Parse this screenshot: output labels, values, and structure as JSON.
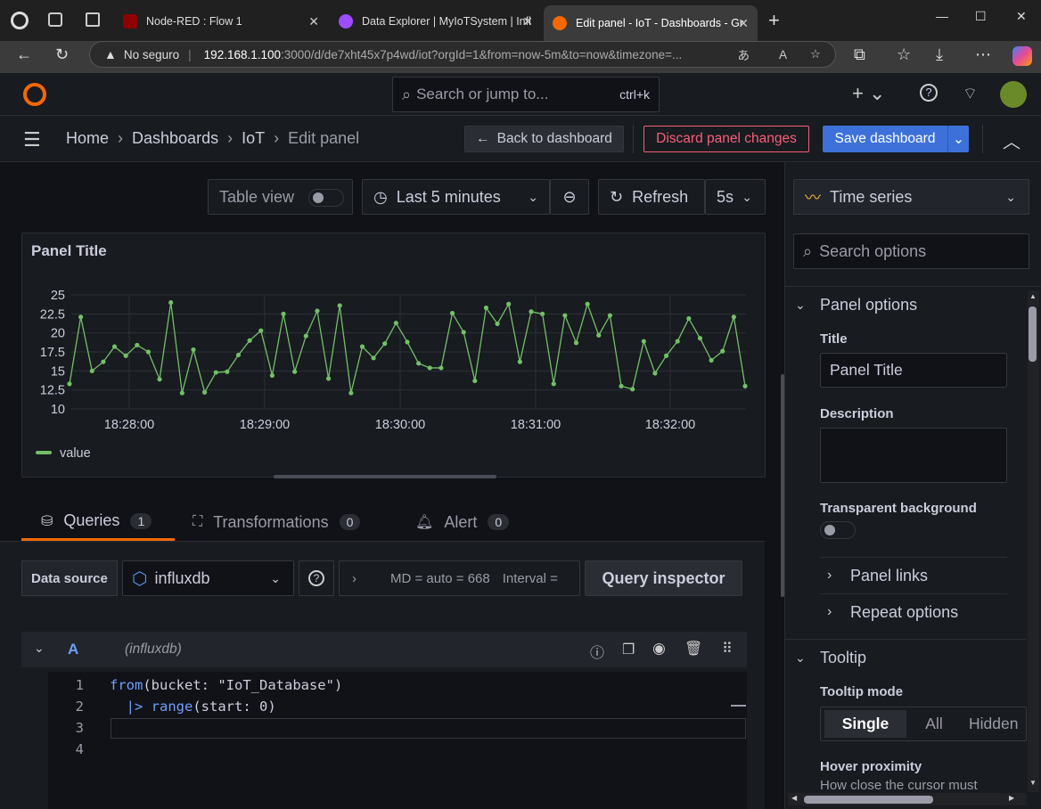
{
  "browser": {
    "tabs": [
      {
        "title": "Node-RED : Flow 1"
      },
      {
        "title": "Data Explorer | MyIoTSystem | Infl"
      },
      {
        "title": "Edit panel - IoT - Dashboards - Gr"
      }
    ],
    "security_label": "No seguro",
    "url_host": "192.168.1.100",
    "url_rest": ":3000/d/de7xht45x7p4wd/iot?orgId=1&from=now-5m&to=now&timezone=..."
  },
  "grafana": {
    "search_placeholder": "Search or jump to...",
    "search_shortcut": "ctrl+k",
    "breadcrumb": [
      "Home",
      "Dashboards",
      "IoT",
      "Edit panel"
    ],
    "back_label": "Back to dashboard",
    "discard_label": "Discard panel changes",
    "save_label": "Save dashboard",
    "table_view_label": "Table view",
    "time_range": "Last 5 minutes",
    "refresh_label": "Refresh",
    "refresh_interval": "5s",
    "panel_title": "Panel Title",
    "tabs": {
      "queries": "Queries",
      "queries_count": "1",
      "transformations": "Transformations",
      "transformations_count": "0",
      "alert": "Alert",
      "alert_count": "0"
    },
    "datasource_label": "Data source",
    "datasource": "influxdb",
    "md_text": "MD = auto = 668",
    "interval_text": "Interval =",
    "query_inspector": "Query inspector",
    "query": {
      "ref": "A",
      "ds": "(influxdb)",
      "lines": [
        {
          "n": "1",
          "parts": [
            {
              "t": "from",
              "c": "#6e9fff"
            },
            {
              "t": "(bucket: ",
              "c": "#ccccdc"
            },
            {
              "t": "\"IoT_Database\"",
              "c": "#ccccdc"
            },
            {
              "t": ")",
              "c": "#ccccdc"
            }
          ]
        },
        {
          "n": "2",
          "parts": [
            {
              "t": "  |> ",
              "c": "#6e9fff"
            },
            {
              "t": "range",
              "c": "#6e9fff"
            },
            {
              "t": "(start: ",
              "c": "#ccccdc"
            },
            {
              "t": "0",
              "c": "#ccccdc"
            },
            {
              "t": ")",
              "c": "#ccccdc"
            }
          ]
        },
        {
          "n": "3",
          "parts": []
        },
        {
          "n": "4",
          "parts": []
        }
      ]
    }
  },
  "side": {
    "viz": "Time series",
    "search_options": "Search options",
    "panel_options": "Panel options",
    "title_label": "Title",
    "title_value": "Panel Title",
    "description_label": "Description",
    "transparent_label": "Transparent background",
    "panel_links": "Panel links",
    "repeat_options": "Repeat options",
    "tooltip": "Tooltip",
    "tooltip_mode_label": "Tooltip mode",
    "tooltip_modes": [
      "Single",
      "All",
      "Hidden"
    ],
    "hover_label": "Hover proximity",
    "hover_desc": "How close the cursor must"
  },
  "chart_data": {
    "type": "line",
    "title": "Panel Title",
    "ylim": [
      10,
      25
    ],
    "y_ticks": [
      "25",
      "22.5",
      "20",
      "17.5",
      "15",
      "12.5",
      "10"
    ],
    "x_ticks": [
      "18:28:00",
      "18:29:00",
      "18:30:00",
      "18:31:00",
      "18:32:00"
    ],
    "series": [
      {
        "name": "value",
        "color": "#73bf69",
        "values": [
          13.3,
          22.1,
          15,
          16.2,
          18.2,
          17,
          18.4,
          17.5,
          13.9,
          24,
          12.1,
          17.8,
          12.2,
          14.8,
          14.9,
          17.1,
          19,
          20.3,
          14.4,
          22.5,
          14.9,
          19.6,
          22.9,
          14,
          23.6,
          12.1,
          18.2,
          16.7,
          18.6,
          21.3,
          18.8,
          16,
          15.4,
          15.4,
          22.6,
          20.1,
          13.7,
          23.3,
          21.2,
          23.8,
          16.2,
          22.8,
          22.5,
          13.3,
          22.3,
          18.7,
          23.8,
          19.7,
          22.3,
          13,
          12.6,
          18.9,
          14.7,
          17,
          18.9,
          21.9,
          19.3,
          16.4,
          17.6,
          22.1,
          13.0
        ]
      }
    ],
    "legend": "bottom-left"
  }
}
